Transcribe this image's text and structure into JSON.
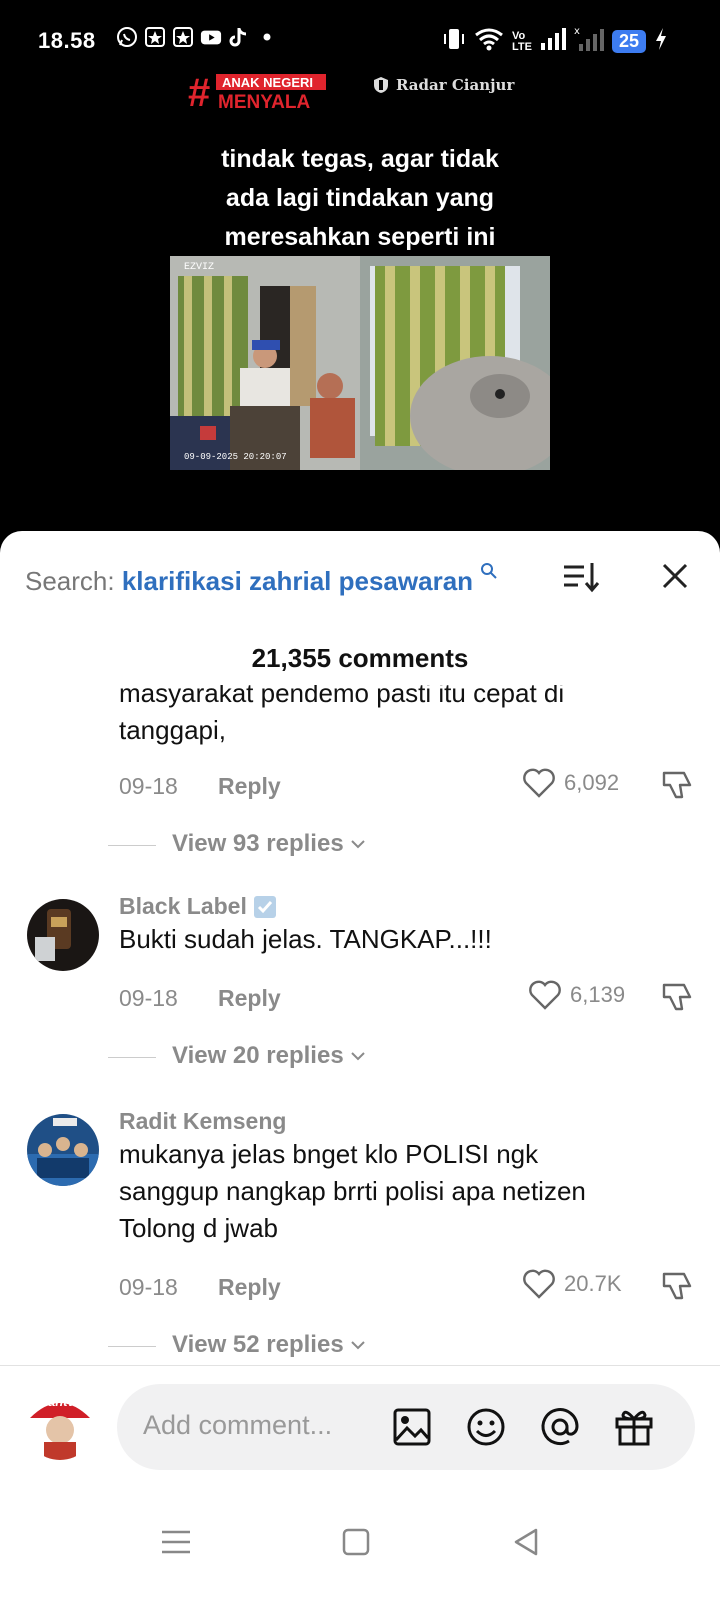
{
  "status": {
    "time": "18.58",
    "battery": "25",
    "left_icons": [
      "whatsapp-icon",
      "badge-icon",
      "badge-icon",
      "youtube-icon",
      "tiktok-icon",
      "dot-icon"
    ],
    "right_icons": [
      "vibrate-icon",
      "wifi-icon",
      "volte-icon",
      "signal-icon",
      "signal-icon",
      "battery-icon",
      "charging-icon"
    ],
    "volte_label": "Vo\nLTE"
  },
  "video": {
    "left_logo_text": "#ANAK NEGERI MENYALA",
    "right_logo_text": "Radar Cianjur",
    "caption_lines": [
      "tindak tegas, agar tidak",
      "ada lagi tindakan yang",
      "meresahkan seperti ini"
    ],
    "cctv_brand": "EZVIZ",
    "cctv_timestamp": "09-09-2025 20:20:07"
  },
  "comments_panel": {
    "search_label": "Search:",
    "search_query": "klarifikasi zahrial pesawaran",
    "count_label": "21,355 comments",
    "comments": [
      {
        "username": "",
        "verified": false,
        "lines": [
          "masyarakat pendemo pasti itu cepat di",
          "tanggapi,"
        ],
        "date": "09-18",
        "reply_label": "Reply",
        "likes": "6,092",
        "view_replies": "View 93 replies"
      },
      {
        "username": "Black Label",
        "verified": true,
        "lines": [
          "Bukti sudah jelas. TANGKAP...!!!"
        ],
        "date": "09-18",
        "reply_label": "Reply",
        "likes": "6,139",
        "view_replies": "View 20 replies"
      },
      {
        "username": "Radit Kemseng",
        "verified": false,
        "lines": [
          "mukanya jelas bnget klo POLISI ngk",
          "sanggup nangkap brrti polisi apa netizen",
          "Tolong d jwab"
        ],
        "date": "09-18",
        "reply_label": "Reply",
        "likes": "20.7K",
        "view_replies": "View 52 replies"
      }
    ],
    "input_placeholder": "Add comment...",
    "my_avatar_text": "antv"
  }
}
